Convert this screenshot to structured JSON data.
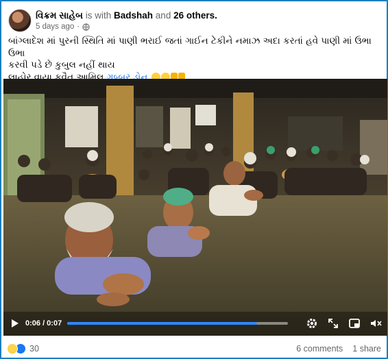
{
  "post": {
    "author": "વિક્રમ સાહેબ",
    "with_text": "is with",
    "tagged": "Badshah",
    "and_text": "and",
    "others": "26 others.",
    "time": "5 days ago",
    "text_line1": "બાંગ્લાદેશ માં પુરની સ્થિતિ માં પાણી ભરાઈ જતાં ગાઈન ટેકીને નમાઝ અદા કરતાં હવે પાણી માં ઉભા ઉભા",
    "text_line2": "કરવી પડે છે કુબુલ નહીં થાય",
    "text_line3": "લાહોર વાયા કુવૈત આમિલ",
    "text_tag": "ગબ્બર ડોન"
  },
  "video": {
    "time_display": "0:06 / 0:07",
    "progress": 0.86,
    "icons": [
      "play-icon",
      "settings-icon",
      "fullscreen-icon",
      "picture-in-picture-icon",
      "volume-muted-icon"
    ]
  },
  "reactions": {
    "count": "30",
    "comments": "6 comments",
    "shares": "1 share",
    "icons": [
      "haha-reaction-icon",
      "like-reaction-icon"
    ]
  },
  "colors": {
    "accent": "#1877f2",
    "progress": "#2e89ff",
    "frame": "#1b7fc4"
  }
}
